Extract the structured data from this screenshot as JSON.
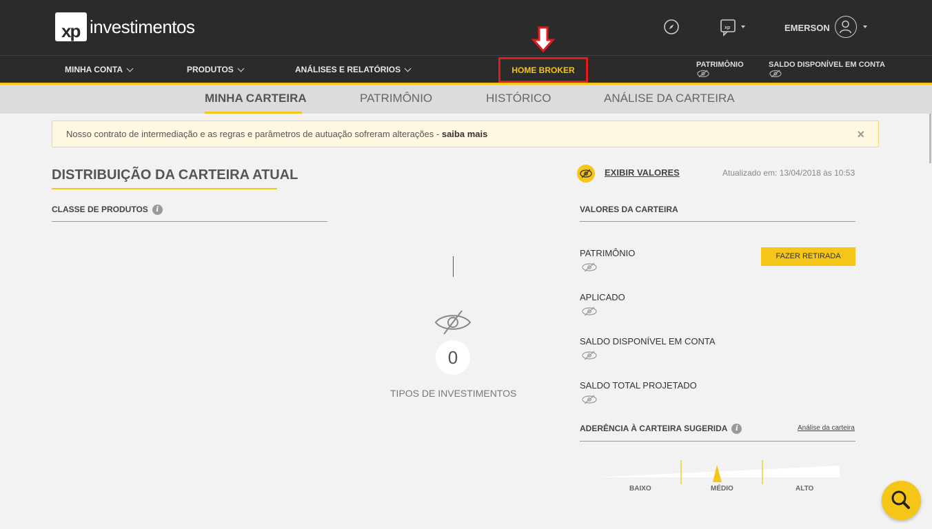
{
  "header": {
    "logo_mark": "xp",
    "logo_text": "investimentos",
    "user_name": "EMERSON",
    "icons": [
      "compass-icon",
      "chat-icon",
      "user-icon"
    ]
  },
  "nav": {
    "items": [
      {
        "label": "MINHA CONTA"
      },
      {
        "label": "PRODUTOS"
      },
      {
        "label": "ANÁLISES E RELATÓRIOS"
      }
    ],
    "home_broker": "HOME BROKER",
    "patrimonio": "PATRIMÔNIO",
    "saldo": "SALDO DISPONÍVEL EM CONTA"
  },
  "tabs": [
    {
      "label": "MINHA CARTEIRA",
      "active": true
    },
    {
      "label": "PATRIMÔNIO"
    },
    {
      "label": "HISTÓRICO"
    },
    {
      "label": "ANÁLISE DA CARTEIRA"
    }
  ],
  "notice": {
    "text": "Nosso contrato de intermediação e as regras e parâmetros de autuação sofreram alterações - ",
    "link": "saiba mais",
    "close": "×"
  },
  "distribution": {
    "title": "DISTRIBUIÇÃO DA CARTEIRA ATUAL",
    "classe_label": "CLASSE DE PRODUTOS",
    "count": "0",
    "count_label": "TIPOS DE INVESTIMENTOS"
  },
  "valores": {
    "exibir": "EXIBIR VALORES",
    "atualizado": "Atualizado em: 13/04/2018 às 10:53",
    "section_label": "VALORES DA CARTEIRA",
    "items": [
      {
        "label": "PATRIMÔNIO"
      },
      {
        "label": "APLICADO"
      },
      {
        "label": "SALDO DISPONÍVEL EM CONTA"
      },
      {
        "label": "SALDO TOTAL PROJETADO"
      }
    ],
    "retirada_button": "FAZER RETIRADA",
    "aderencia_label": "ADERÊNCIA À CARTEIRA SUGERIDA",
    "analise_link": "Análise da carteira",
    "gauge": {
      "labels": [
        "BAIXO",
        "MÉDIO",
        "ALTO"
      ],
      "level": "MÉDIO"
    }
  },
  "colors": {
    "accent": "#f5c518",
    "header_bg": "#2b2b2b",
    "highlight": "#e31b1b"
  }
}
